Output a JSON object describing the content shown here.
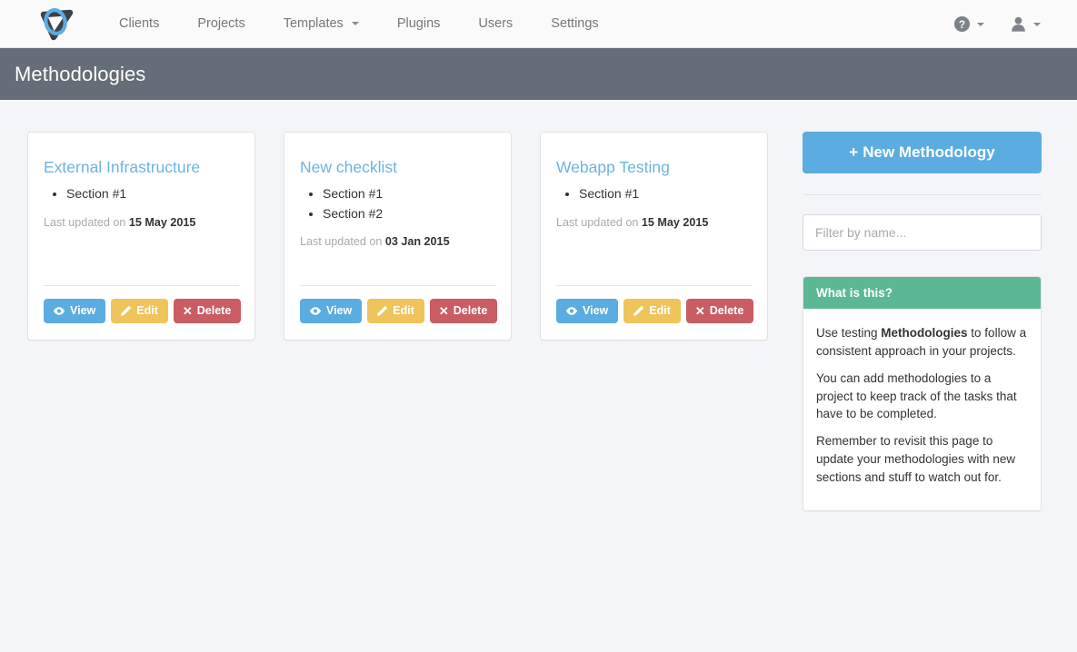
{
  "navbar": {
    "logo_name": "logo-icon",
    "links": [
      {
        "label": "Clients",
        "has_caret": false
      },
      {
        "label": "Projects",
        "has_caret": false
      },
      {
        "label": "Templates",
        "has_caret": true
      },
      {
        "label": "Plugins",
        "has_caret": false
      },
      {
        "label": "Users",
        "has_caret": false
      },
      {
        "label": "Settings",
        "has_caret": false
      }
    ],
    "help_icon": "question-circle-icon",
    "user_icon": "user-icon"
  },
  "page_header": {
    "title": "Methodologies",
    "background_color": "#656d78"
  },
  "cards": [
    {
      "title": "External Infrastructure",
      "sections": [
        "Section #1"
      ],
      "updated_label": "Last updated on",
      "updated_date": "15 May 2015",
      "buttons": {
        "view": "View",
        "edit": "Edit",
        "delete": "Delete"
      }
    },
    {
      "title": "New checklist",
      "sections": [
        "Section #1",
        "Section #2"
      ],
      "updated_label": "Last updated on",
      "updated_date": "03 Jan 2015",
      "buttons": {
        "view": "View",
        "edit": "Edit",
        "delete": "Delete"
      }
    },
    {
      "title": "Webapp Testing",
      "sections": [
        "Section #1"
      ],
      "updated_label": "Last updated on",
      "updated_date": "15 May 2015",
      "buttons": {
        "view": "View",
        "edit": "Edit",
        "delete": "Delete"
      }
    }
  ],
  "sidebar": {
    "new_button": {
      "plus": "+",
      "label": "New Methodology",
      "color": "#5bace0"
    },
    "filter": {
      "value": "",
      "placeholder": "Filter by name..."
    },
    "panel": {
      "heading": "What is this?",
      "heading_color": "#5cb894",
      "paragraphs": [
        {
          "pre": "Use testing ",
          "bold": "Methodologies",
          "post": " to follow a consistent approach in your projects."
        },
        {
          "pre": "You can add methodologies to a project to keep track of the tasks that have to be completed.",
          "bold": "",
          "post": ""
        },
        {
          "pre": "Remember to revisit this page to update your methodologies with new sections and stuff to watch out for.",
          "bold": "",
          "post": ""
        }
      ]
    }
  },
  "colors": {
    "page_background": "#f4f5f9",
    "navbar_background": "#fafafa",
    "card_title": "#6eb3e4",
    "btn_view": "#5bace0",
    "btn_edit": "#eec45b",
    "btn_delete": "#ca5c63"
  }
}
